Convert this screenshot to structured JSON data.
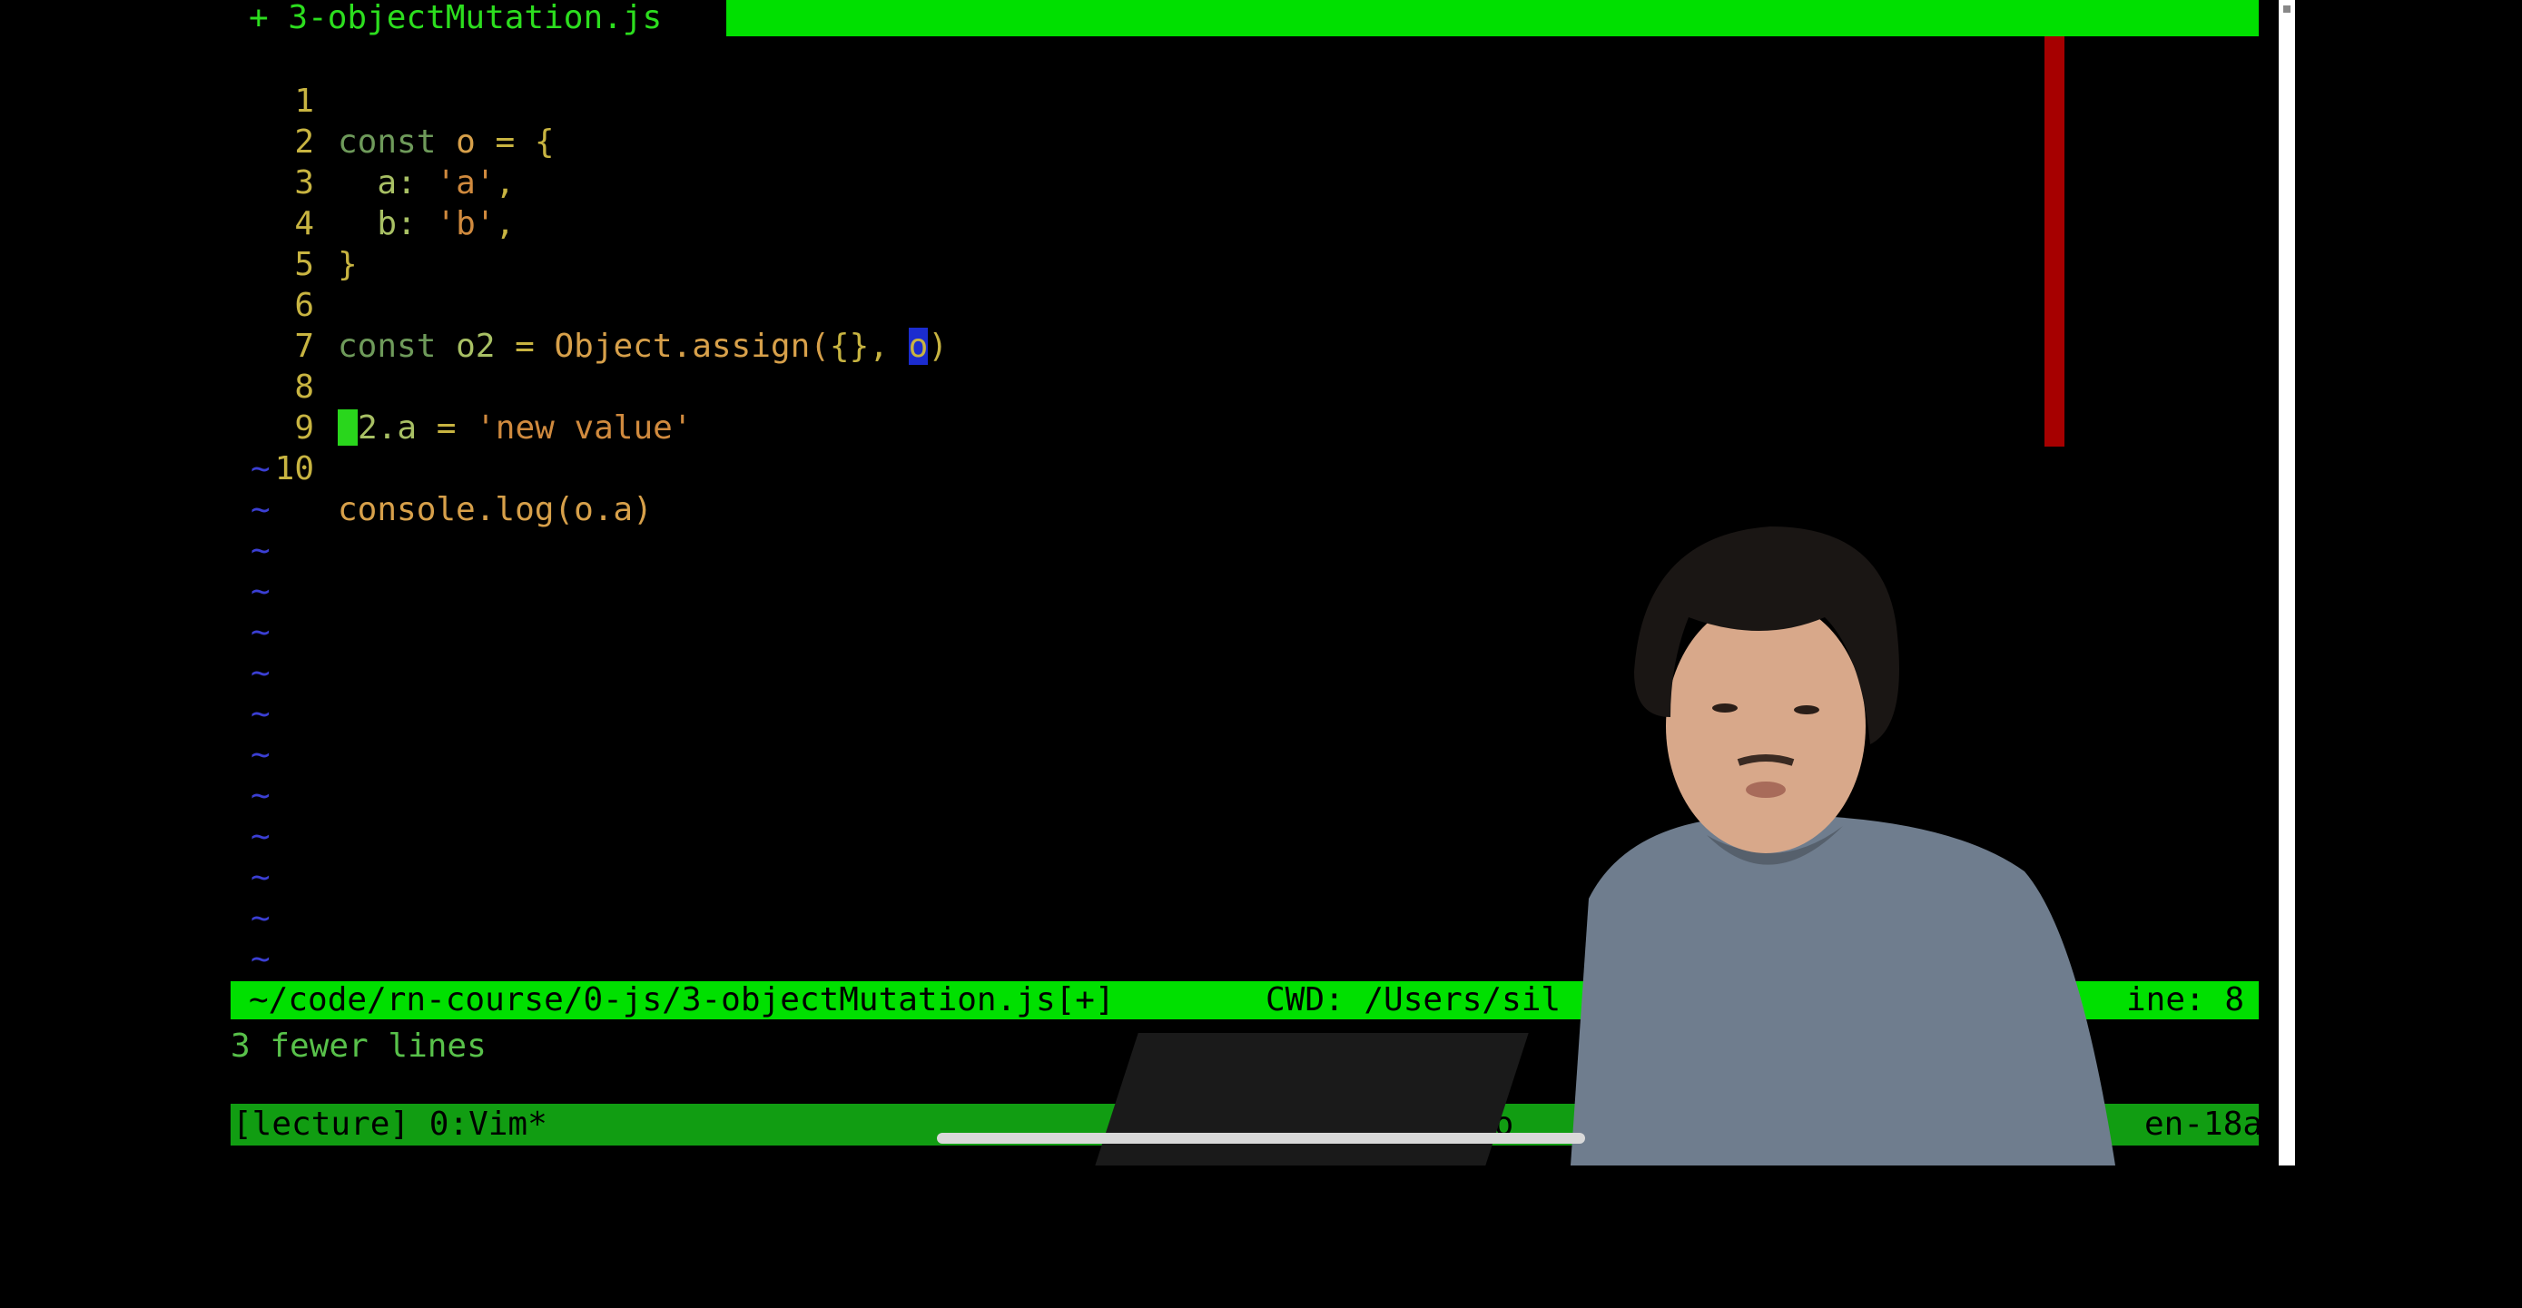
{
  "tab": {
    "label": "+ 3-objectMutation.js"
  },
  "code_lines": [
    {
      "num": "1"
    },
    {
      "num": "2"
    },
    {
      "num": "3"
    },
    {
      "num": "4"
    },
    {
      "num": "5"
    },
    {
      "num": "6"
    },
    {
      "num": "7"
    },
    {
      "num": "8"
    },
    {
      "num": "9"
    },
    {
      "num": "10"
    }
  ],
  "code_tokens": {
    "l1": [
      "const",
      "o",
      "=",
      "{"
    ],
    "l2": [
      "a:",
      "'a'",
      ","
    ],
    "l3": [
      "b:",
      "'b'",
      ","
    ],
    "l4": [
      "}"
    ],
    "l6": [
      "const",
      "o2",
      "=",
      "Object",
      ".assign(",
      "{}",
      ",",
      "o",
      ")"
    ],
    "l8": [
      "2.a",
      "=",
      "'new value'"
    ],
    "l10": [
      "console.log(o.a)"
    ]
  },
  "tilde": "~",
  "status": {
    "path": "~/code/rn-course/0-js/3-objectMutation.js[+]",
    "cwd": "CWD: /Users/sil",
    "line": "ine: 8"
  },
  "message": "3 fewer lines",
  "tmux": {
    "left": "[lecture] 0:Vim*",
    "mid": "io",
    "right": "en-18a"
  },
  "colors": {
    "tab_fill": "#00e000",
    "statusline": "#00e000",
    "tmux": "#119d12",
    "scroll_mark": "#a60000",
    "tilde": "#3b3fd4",
    "selection": "#1b2ccf"
  },
  "icons": {
    "presenter": "presenter-photo",
    "laptop": "laptop",
    "home": "home-indicator"
  }
}
